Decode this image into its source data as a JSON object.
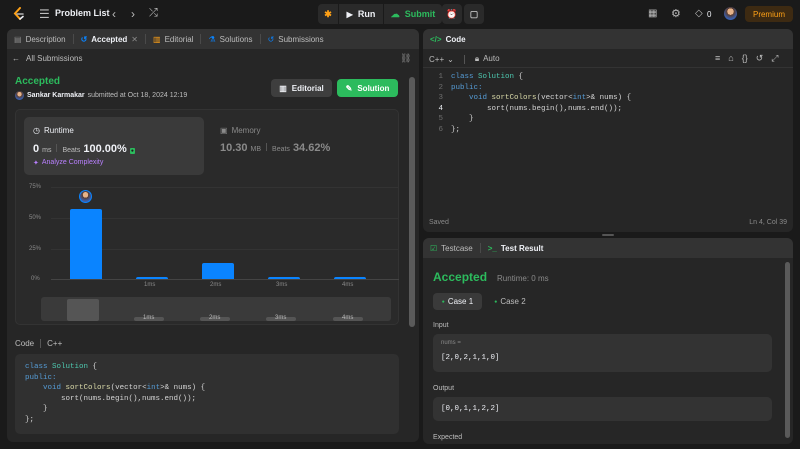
{
  "topbar": {
    "problem_list": "Problem List",
    "run": "Run",
    "submit": "Submit",
    "streak": "0",
    "premium": "Premium"
  },
  "left_tabs": [
    {
      "label": "Description"
    },
    {
      "label": "Accepted",
      "close": "✕"
    },
    {
      "label": "Editorial"
    },
    {
      "label": "Solutions"
    },
    {
      "label": "Submissions"
    }
  ],
  "submission": {
    "back": "All Submissions",
    "status": "Accepted",
    "user": "Sankar Karmakar",
    "submitted_text": "submitted at Oct 18, 2024 12:19",
    "editorial_btn": "Editorial",
    "solution_btn": "Solution"
  },
  "runtime": {
    "label": "Runtime",
    "value": "0",
    "unit": "ms",
    "beats_label": "Beats",
    "beats": "100.00%",
    "analyze": "Analyze Complexity"
  },
  "memory": {
    "label": "Memory",
    "value": "10.30",
    "unit": "MB",
    "beats_label": "Beats",
    "beats": "34.62%"
  },
  "chart_data": {
    "type": "bar",
    "y_ticks": [
      "75%",
      "50%",
      "25%",
      "0%"
    ],
    "categories": [
      "0ms",
      "1ms",
      "2ms",
      "3ms",
      "4ms"
    ],
    "x_labels": [
      "",
      "1ms",
      "2ms",
      "3ms",
      "4ms"
    ],
    "values": [
      57,
      2,
      13,
      2,
      2
    ],
    "ylim": [
      0,
      75
    ],
    "highlight_index": 0,
    "mini_labels": [
      "1ms",
      "2ms",
      "3ms",
      "4ms"
    ]
  },
  "code_section": {
    "label": "Code",
    "lang": "C++"
  },
  "right": {
    "code_tab": "Code",
    "lang": "C++",
    "auto": "Auto",
    "saved": "Saved",
    "cursor": "Ln 4, Col 39",
    "line_numbers": [
      "1",
      "2",
      "3",
      "4",
      "5",
      "6"
    ]
  },
  "code": {
    "line1_kw": "class",
    "line1_name": "Solution",
    "line1_brace": " {",
    "line2": "public:",
    "line3_kw": "void",
    "line3_fn": "sortColors",
    "line3_a": "(vector<",
    "line3_int": "int",
    "line3_b": ">& nums) {",
    "line4": "sort(nums.begin(),nums.end());",
    "line5": "}",
    "line6": "};"
  },
  "result": {
    "testcase_tab": "Testcase",
    "result_tab": "Test Result",
    "status": "Accepted",
    "runtime": "Runtime: 0 ms",
    "case1": "Case 1",
    "case2": "Case 2",
    "input_label": "Input",
    "var": "nums =",
    "input_value": "[2,0,2,1,1,0]",
    "output_label": "Output",
    "output_value": "[0,0,1,1,2,2]",
    "expected_label": "Expected"
  }
}
